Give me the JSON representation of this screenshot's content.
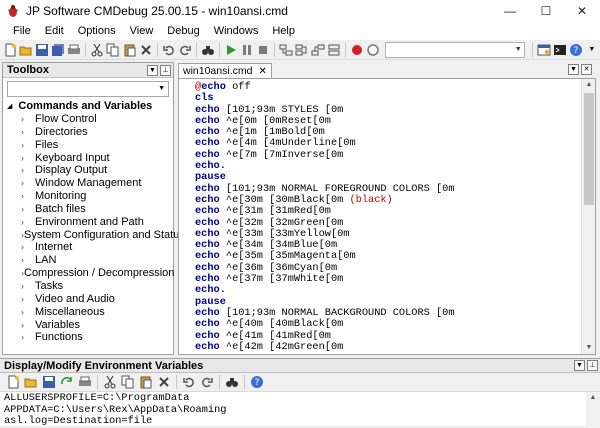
{
  "window": {
    "title": "JP Software CMDebug 25.00.15 - win10ansi.cmd",
    "minimize_glyph": "—",
    "maximize_glyph": "☐",
    "close_glyph": "✕"
  },
  "menu": [
    "File",
    "Edit",
    "Options",
    "View",
    "Debug",
    "Windows",
    "Help"
  ],
  "toolbox": {
    "title": "Toolbox",
    "search_value": "",
    "root": "Commands and Variables",
    "items": [
      "Flow Control",
      "Directories",
      "Files",
      "Keyboard Input",
      "Display Output",
      "Window Management",
      "Monitoring",
      "Batch files",
      "Environment and Path",
      "System Configuration and Status",
      "Internet",
      "LAN",
      "Compression / Decompression",
      "Tasks",
      "Video and Audio",
      "Miscellaneous",
      "Variables",
      "Functions"
    ]
  },
  "editor": {
    "tab_label": "win10ansi.cmd",
    "lines": [
      {
        "parts": [
          {
            "t": "@",
            "c": "at"
          },
          {
            "t": "echo",
            "c": "kw"
          },
          {
            "t": " off",
            "c": ""
          }
        ]
      },
      {
        "parts": [
          {
            "t": "cls",
            "c": "kw"
          }
        ]
      },
      {
        "parts": [
          {
            "t": "echo",
            "c": "kw"
          },
          {
            "t": " [101;93m STYLES [0m",
            "c": ""
          }
        ]
      },
      {
        "parts": [
          {
            "t": "echo",
            "c": "kw"
          },
          {
            "t": " ^e[0m [0mReset[0m",
            "c": ""
          }
        ]
      },
      {
        "parts": [
          {
            "t": "echo",
            "c": "kw"
          },
          {
            "t": " ^e[1m [1mBold[0m",
            "c": ""
          }
        ]
      },
      {
        "parts": [
          {
            "t": "echo",
            "c": "kw"
          },
          {
            "t": " ^e[4m [4mUnderline[0m",
            "c": ""
          }
        ]
      },
      {
        "parts": [
          {
            "t": "echo",
            "c": "kw"
          },
          {
            "t": " ^e[7m [7mInverse[0m",
            "c": ""
          }
        ]
      },
      {
        "parts": [
          {
            "t": "echo.",
            "c": "kw"
          }
        ]
      },
      {
        "parts": [
          {
            "t": "pause",
            "c": "kw"
          }
        ]
      },
      {
        "parts": [
          {
            "t": "echo",
            "c": "kw"
          },
          {
            "t": " [101;93m NORMAL FOREGROUND COLORS [0m",
            "c": ""
          }
        ]
      },
      {
        "parts": [
          {
            "t": "echo",
            "c": "kw"
          },
          {
            "t": " ^e[30m [30mBlack[0m ",
            "c": ""
          },
          {
            "t": "(black)",
            "c": "red"
          }
        ]
      },
      {
        "parts": [
          {
            "t": "echo",
            "c": "kw"
          },
          {
            "t": " ^e[31m [31mRed[0m",
            "c": ""
          }
        ]
      },
      {
        "parts": [
          {
            "t": "echo",
            "c": "kw"
          },
          {
            "t": " ^e[32m [32mGreen[0m",
            "c": ""
          }
        ]
      },
      {
        "parts": [
          {
            "t": "echo",
            "c": "kw"
          },
          {
            "t": " ^e[33m [33mYellow[0m",
            "c": ""
          }
        ]
      },
      {
        "parts": [
          {
            "t": "echo",
            "c": "kw"
          },
          {
            "t": " ^e[34m [34mBlue[0m",
            "c": ""
          }
        ]
      },
      {
        "parts": [
          {
            "t": "echo",
            "c": "kw"
          },
          {
            "t": " ^e[35m [35mMagenta[0m",
            "c": ""
          }
        ]
      },
      {
        "parts": [
          {
            "t": "echo",
            "c": "kw"
          },
          {
            "t": " ^e[36m [36mCyan[0m",
            "c": ""
          }
        ]
      },
      {
        "parts": [
          {
            "t": "echo",
            "c": "kw"
          },
          {
            "t": " ^e[37m [37mWhite[0m",
            "c": ""
          }
        ]
      },
      {
        "parts": [
          {
            "t": "echo.",
            "c": "kw"
          }
        ]
      },
      {
        "parts": [
          {
            "t": "pause",
            "c": "kw"
          }
        ]
      },
      {
        "parts": [
          {
            "t": "echo",
            "c": "kw"
          },
          {
            "t": " [101;93m NORMAL BACKGROUND COLORS [0m",
            "c": ""
          }
        ]
      },
      {
        "parts": [
          {
            "t": "echo",
            "c": "kw"
          },
          {
            "t": " ^e[40m [40mBlack[0m",
            "c": ""
          }
        ]
      },
      {
        "parts": [
          {
            "t": "echo",
            "c": "kw"
          },
          {
            "t": " ^e[41m [41mRed[0m",
            "c": ""
          }
        ]
      },
      {
        "parts": [
          {
            "t": "echo",
            "c": "kw"
          },
          {
            "t": " ^e[42m [42mGreen[0m",
            "c": ""
          }
        ]
      }
    ]
  },
  "env_panel": {
    "title": "Display/Modify Environment Variables",
    "lines": [
      "ALLUSERSPROFILE=C:\\ProgramData",
      "APPDATA=C:\\Users\\Rex\\AppData\\Roaming",
      "asl.log=Destination=file"
    ]
  },
  "colors": {
    "keyword": "#00008b",
    "at_sign": "#b00000",
    "highlight_red": "#cc0000",
    "run_green": "#2e9a2e",
    "breakpoint_red": "#d22020"
  }
}
